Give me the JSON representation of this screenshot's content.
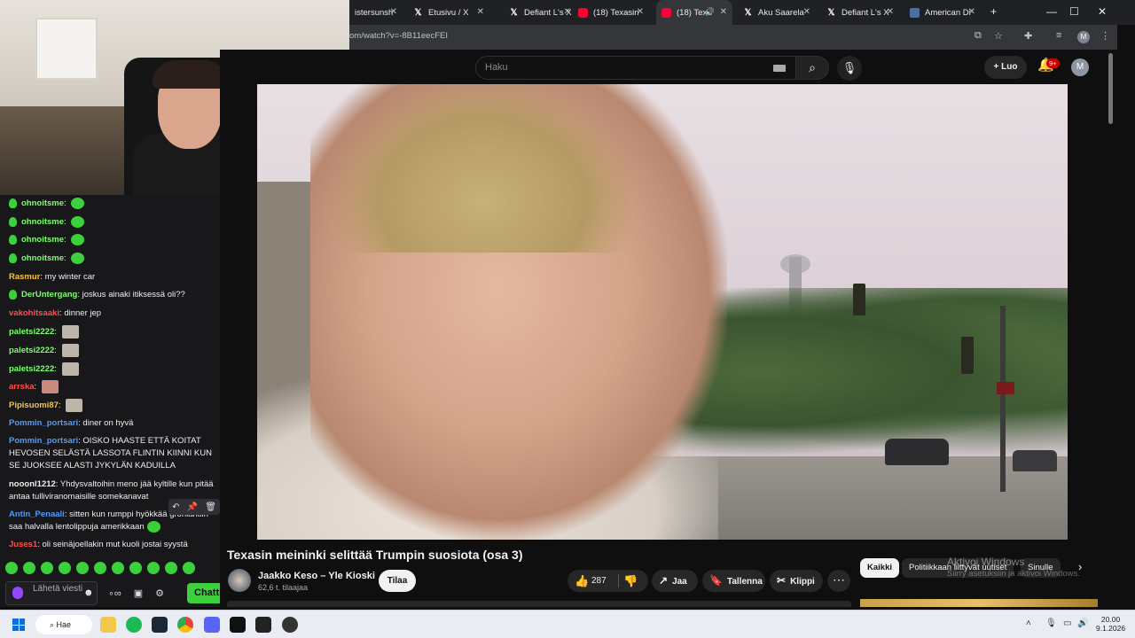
{
  "browser": {
    "tabs": [
      {
        "label": "istersunsh",
        "icon": "",
        "active": false
      },
      {
        "label": "Etusivu / X",
        "icon": "x",
        "active": false
      },
      {
        "label": "Defiant L's X",
        "icon": "x",
        "active": false
      },
      {
        "label": "(18) Texasin",
        "icon": "yt",
        "active": false
      },
      {
        "label": "(18) Texa",
        "icon": "yt",
        "active": true
      },
      {
        "label": "Aku Saarela",
        "icon": "x",
        "active": false
      },
      {
        "label": "Defiant L's X",
        "icon": "x",
        "active": false
      },
      {
        "label": "American Di",
        "icon": "doc",
        "active": false
      }
    ],
    "url": "om/watch?v=-8B11eecFEI",
    "profile_initial": "M"
  },
  "youtube": {
    "search_placeholder": "Haku",
    "create_label": "Luo",
    "notifications_badge": "9+",
    "avatar_initial": "M",
    "video": {
      "title": "Texasin meininki selittää Trumpin suosiota (osa 3)",
      "channel": "Jaakko Keso – Yle Kioski",
      "subscribers": "62,6 t. tilaajaa",
      "subscribe_label": "Tilaa",
      "likes": "287",
      "share_label": "Jaa",
      "save_label": "Tallenna",
      "clip_label": "Klippi"
    },
    "chips": [
      "Kaikki",
      "Politiikkaan liittyvät uutiset",
      "Sinulle"
    ],
    "activate_windows": {
      "title": "Aktivoi Windows",
      "subtitle": "Siirry asetuksiin ja aktivoi Windows."
    }
  },
  "chat": {
    "messages": [
      {
        "user": "ohnoitsme",
        "color": "#7cff6b",
        "text": "",
        "emote": "green",
        "badge": true
      },
      {
        "user": "ohnoitsme",
        "color": "#7cff6b",
        "text": "",
        "emote": "green",
        "badge": true
      },
      {
        "user": "ohnoitsme",
        "color": "#7cff6b",
        "text": "",
        "emote": "green",
        "badge": true
      },
      {
        "user": "ohnoitsme",
        "color": "#7cff6b",
        "text": "",
        "emote": "green",
        "badge": true
      },
      {
        "user": "Rasmur",
        "color": "#f5c542",
        "text": "my winter car",
        "emote": "",
        "badge": false
      },
      {
        "user": "DerUntergang",
        "color": "#7cff6b",
        "text": "joskus ainaki itiksessä oli??",
        "emote": "",
        "badge": true
      },
      {
        "user": "vakohitsaaki",
        "color": "#ff4f4f",
        "text": "dinner jep",
        "emote": "",
        "badge": false
      },
      {
        "user": "paletsi2222",
        "color": "#7cff6b",
        "text": "",
        "emote": "cat",
        "badge": false
      },
      {
        "user": "paletsi2222",
        "color": "#7cff6b",
        "text": "",
        "emote": "cat",
        "badge": false
      },
      {
        "user": "paletsi2222",
        "color": "#7cff6b",
        "text": "",
        "emote": "cat",
        "badge": false
      },
      {
        "user": "arrska",
        "color": "#ff4f4f",
        "text": "",
        "emote": "pink",
        "badge": false
      },
      {
        "user": "Pipisuomi87",
        "color": "#f5c542",
        "text": "",
        "emote": "cat",
        "badge": false
      },
      {
        "user": "Pommin_portsari",
        "color": "#4f9bff",
        "text": "diner on hyvä",
        "emote": "",
        "badge": false
      },
      {
        "user": "Pommin_portsari",
        "color": "#4f9bff",
        "text": "OISKO HAASTE ETTÄ KOITAT HEVOSEN SELÄSTÄ LASSOTA FLINTIN KIINNI KUN SE JUOKSEE ALASTI JYKYLÄN KADUILLA",
        "emote": "",
        "badge": false
      },
      {
        "user": "nooonl1212",
        "color": "#efeff1",
        "text": "Yhdysvaltoihin meno jää kyltille kun pitää antaa tulliviranomaisille somekanavat",
        "emote": "",
        "badge": false
      },
      {
        "user": "Antin_Penaali",
        "color": "#4f9bff",
        "text": "sitten kun rumppi hyökkää grönlantiin saa halvalla lentolippuja amerikkaan",
        "emote": "green",
        "badge": false
      },
      {
        "user": "Juses1",
        "color": "#ff4f4f",
        "text": "oli seinäjoellakin mut kuoli jostai syystä",
        "emote": "",
        "badge": false
      }
    ],
    "input_placeholder": "Lähetä viesti",
    "chat_button_label": "Chatti"
  },
  "taskbar": {
    "search_label": "Hae",
    "time": "20.00",
    "date": "9.1.2026"
  }
}
